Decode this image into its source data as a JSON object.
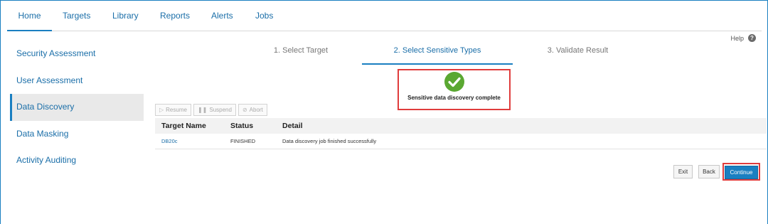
{
  "nav": {
    "tabs": [
      {
        "label": "Home",
        "active": true
      },
      {
        "label": "Targets"
      },
      {
        "label": "Library"
      },
      {
        "label": "Reports"
      },
      {
        "label": "Alerts"
      },
      {
        "label": "Jobs"
      }
    ]
  },
  "help": {
    "label": "Help",
    "icon": "help-icon"
  },
  "sidebar": {
    "items": [
      {
        "label": "Security Assessment"
      },
      {
        "label": "User Assessment"
      },
      {
        "label": "Data Discovery",
        "active": true
      },
      {
        "label": "Data Masking"
      },
      {
        "label": "Activity Auditing"
      }
    ]
  },
  "wizard": {
    "steps": [
      {
        "label": "1. Select Target"
      },
      {
        "label": "2. Select Sensitive Types",
        "active": true
      },
      {
        "label": "3. Validate Result"
      }
    ]
  },
  "status": {
    "icon": "check-circle-icon",
    "message": "Sensitive data discovery complete",
    "color": "#5aa832"
  },
  "toolbar": {
    "resume": "Resume",
    "suspend": "Suspend",
    "abort": "Abort"
  },
  "table": {
    "columns": [
      "Target Name",
      "Status",
      "Detail"
    ],
    "rows": [
      {
        "target": "DB20c",
        "status": "FINISHED",
        "detail": "Data discovery job finished successfully"
      }
    ]
  },
  "actions": {
    "exit": "Exit",
    "back": "Back",
    "continue": "Continue"
  },
  "colors": {
    "accent": "#1a7fc1",
    "highlight": "#e03c3c"
  }
}
